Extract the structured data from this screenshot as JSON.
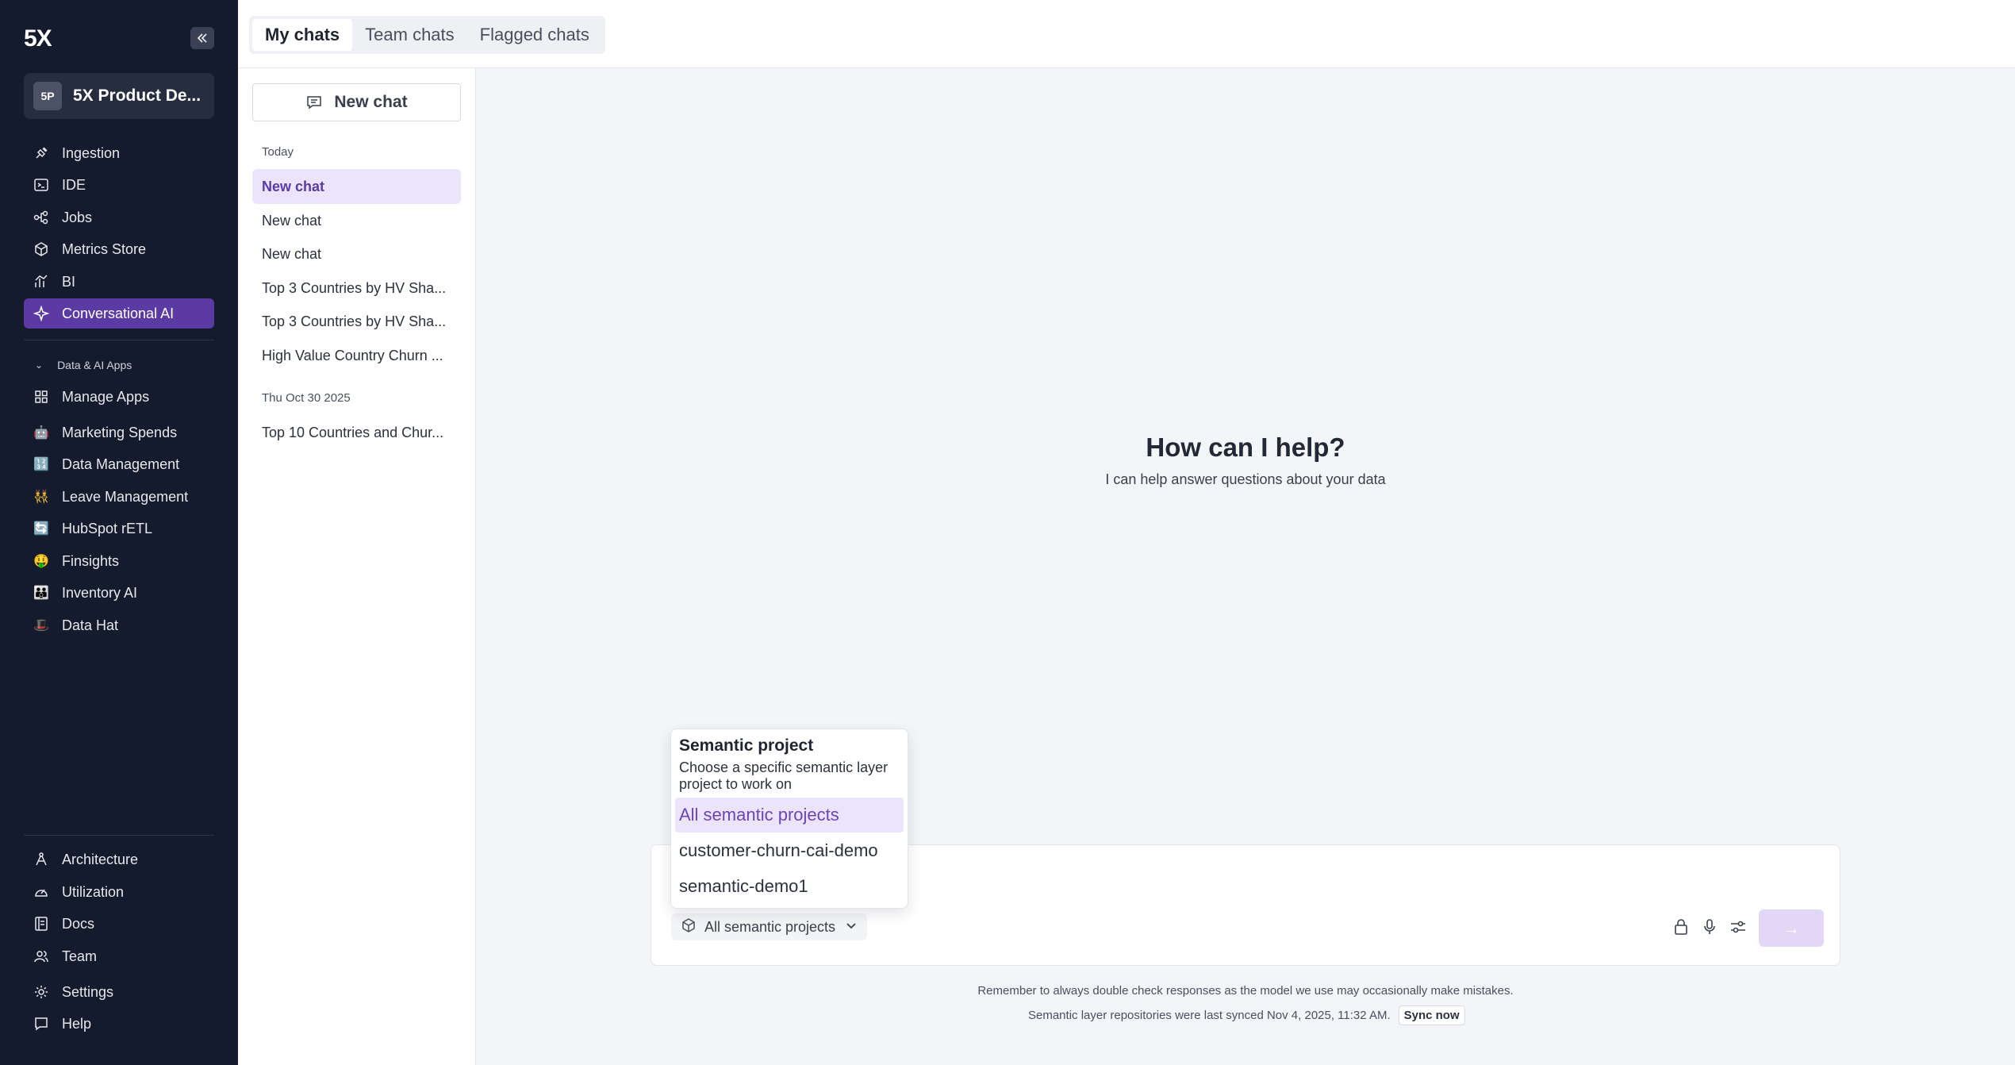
{
  "app": {
    "logo": "5X",
    "workspace_badge": "5P",
    "workspace_name": "5X Product De..."
  },
  "sidebar": {
    "main": [
      {
        "label": "Ingestion",
        "icon": "plug-icon"
      },
      {
        "label": "IDE",
        "icon": "terminal-icon"
      },
      {
        "label": "Jobs",
        "icon": "workflow-icon"
      },
      {
        "label": "Metrics Store",
        "icon": "cube-icon"
      },
      {
        "label": "BI",
        "icon": "chart-icon"
      },
      {
        "label": "Conversational AI",
        "icon": "sparkle-icon",
        "active": true
      }
    ],
    "section_label": "Data & AI Apps",
    "apps": [
      {
        "label": "Manage Apps",
        "icon": "grid-icon"
      },
      {
        "label": "Marketing Spends",
        "icon": "🤖"
      },
      {
        "label": "Data Management",
        "icon": "🔢"
      },
      {
        "label": "Leave Management",
        "icon": "👯"
      },
      {
        "label": "HubSpot rETL",
        "icon": "🔄"
      },
      {
        "label": "Finsights",
        "icon": "🤑"
      },
      {
        "label": "Inventory AI",
        "icon": "👪"
      },
      {
        "label": "Data Hat",
        "icon": "🎩"
      }
    ],
    "bottom": [
      {
        "label": "Architecture",
        "icon": "architecture-icon"
      },
      {
        "label": "Utilization",
        "icon": "gauge-icon"
      },
      {
        "label": "Docs",
        "icon": "docs-icon"
      },
      {
        "label": "Team",
        "icon": "team-icon"
      },
      {
        "label": "Settings",
        "icon": "gear-icon"
      },
      {
        "label": "Help",
        "icon": "help-icon"
      }
    ]
  },
  "tabs": [
    "My chats",
    "Team chats",
    "Flagged chats"
  ],
  "chatlist": {
    "new_chat_label": "New chat",
    "groups": [
      {
        "label": "Today",
        "items": [
          "New chat",
          "New chat",
          "New chat",
          "Top 3 Countries by HV Sha...",
          "Top 3 Countries by HV Sha...",
          "High Value Country Churn ..."
        ]
      },
      {
        "label": "Thu Oct 30 2025",
        "items": [
          "Top 10 Countries and Chur..."
        ]
      }
    ]
  },
  "main": {
    "title": "How can I help?",
    "subtitle": "I can help answer questions about your data"
  },
  "composer": {
    "project_value": "All semantic projects",
    "footer_note": "Remember to always double check responses as the model we use may occasionally make mistakes.",
    "sync_note": "Semantic layer repositories were last synced Nov 4, 2025, 11:32 AM.",
    "sync_label": "Sync now"
  },
  "dropdown": {
    "title": "Semantic project",
    "description": "Choose a specific semantic layer project to work on",
    "options": [
      "All semantic projects",
      "customer-churn-cai-demo",
      "semantic-demo1"
    ],
    "selected": "All semantic projects"
  },
  "colors": {
    "sidebar_bg": "#141b2c",
    "accent": "#5b3aa3",
    "accent_light": "#ece4fb"
  }
}
